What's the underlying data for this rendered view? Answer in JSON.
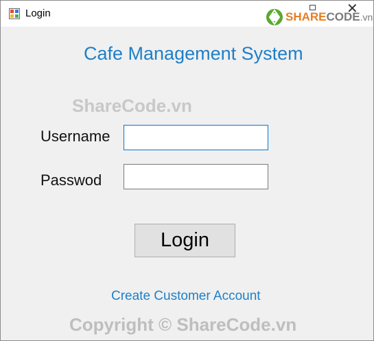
{
  "window": {
    "title": "Login",
    "icon": "winforms-app-icon",
    "controls": [
      "maximize-icon",
      "close-icon"
    ],
    "close_glyph": "✕"
  },
  "watermark_logo": {
    "brand_share": "SHARE",
    "brand_code": "CODE",
    "brand_tld": ".vn",
    "colors": {
      "share": "#e67e22",
      "code": "#7a7a7a"
    }
  },
  "form": {
    "heading": "Cafe Management System",
    "username_label": "Username",
    "username_value": "",
    "password_label": "Passwod",
    "password_value": "",
    "login_button": "Login",
    "create_account_link": "Create Customer Account"
  },
  "watermarks": {
    "center": "ShareCode.vn",
    "bottom": "Copyright © ShareCode.vn"
  },
  "colors": {
    "heading": "#1e7fc8",
    "link": "#1e7fc8",
    "focus_border": "#0078d7",
    "window_bg": "#f0f0f0",
    "button_bg": "#e1e1e1"
  }
}
